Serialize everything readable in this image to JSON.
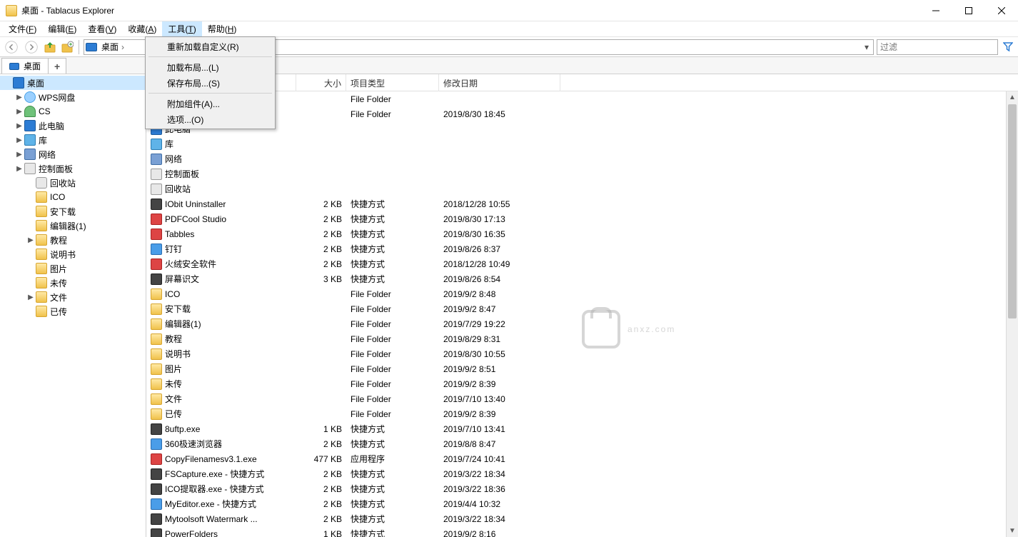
{
  "window": {
    "title": "桌面 - Tablacus Explorer"
  },
  "menubar": [
    {
      "label": "文件",
      "key": "F"
    },
    {
      "label": "编辑",
      "key": "E"
    },
    {
      "label": "查看",
      "key": "V"
    },
    {
      "label": "收藏",
      "key": "A"
    },
    {
      "label": "工具",
      "key": "T",
      "active": true
    },
    {
      "label": "帮助",
      "key": "H"
    }
  ],
  "tools_menu": [
    {
      "label": "重新加载自定义(R)"
    },
    {
      "sep": true
    },
    {
      "label": "加载布局...(L)"
    },
    {
      "label": "保存布局...(S)"
    },
    {
      "sep": true
    },
    {
      "label": "附加组件(A)..."
    },
    {
      "label": "选项...(O)"
    }
  ],
  "address": {
    "crumb": "桌面"
  },
  "filter": {
    "placeholder": "过滤"
  },
  "tabs": [
    {
      "label": "桌面",
      "active": true
    }
  ],
  "tree": [
    {
      "depth": 0,
      "icon": "ic-monitor",
      "label": "桌面",
      "twisty": "",
      "selected": true
    },
    {
      "depth": 1,
      "icon": "ic-cloud",
      "label": "WPS网盘",
      "twisty": ">"
    },
    {
      "depth": 1,
      "icon": "ic-user",
      "label": "CS",
      "twisty": ">"
    },
    {
      "depth": 1,
      "icon": "ic-monitor",
      "label": "此电脑",
      "twisty": ">"
    },
    {
      "depth": 1,
      "icon": "ic-lib",
      "label": "库",
      "twisty": ">"
    },
    {
      "depth": 1,
      "icon": "ic-net",
      "label": "网络",
      "twisty": ">"
    },
    {
      "depth": 1,
      "icon": "ic-panel",
      "label": "控制面板",
      "twisty": ">"
    },
    {
      "depth": 2,
      "icon": "ic-bin",
      "label": "回收站",
      "twisty": ""
    },
    {
      "depth": 2,
      "icon": "ic-folder",
      "label": "ICO",
      "twisty": ""
    },
    {
      "depth": 2,
      "icon": "ic-folder",
      "label": "安下载",
      "twisty": ""
    },
    {
      "depth": 2,
      "icon": "ic-folder",
      "label": "编辑器(1)",
      "twisty": ""
    },
    {
      "depth": 2,
      "icon": "ic-folder",
      "label": "教程",
      "twisty": ">"
    },
    {
      "depth": 2,
      "icon": "ic-folder",
      "label": "说明书",
      "twisty": ""
    },
    {
      "depth": 2,
      "icon": "ic-folder",
      "label": "图片",
      "twisty": ""
    },
    {
      "depth": 2,
      "icon": "ic-folder",
      "label": "未传",
      "twisty": ""
    },
    {
      "depth": 2,
      "icon": "ic-folder",
      "label": "文件",
      "twisty": ">"
    },
    {
      "depth": 2,
      "icon": "ic-folder",
      "label": "已传",
      "twisty": ""
    }
  ],
  "columns": {
    "name": "",
    "size": "大小",
    "type": "项目类型",
    "date": "修改日期"
  },
  "rows": [
    {
      "icon": "ic-cloud",
      "name": "",
      "size": "",
      "type": "File Folder",
      "date": ""
    },
    {
      "icon": "ic-user",
      "name": "",
      "size": "",
      "type": "File Folder",
      "date": "2019/8/30 18:45"
    },
    {
      "icon": "ic-monitor",
      "name": "此电脑",
      "size": "",
      "type": "",
      "date": ""
    },
    {
      "icon": "ic-lib",
      "name": "库",
      "size": "",
      "type": "",
      "date": ""
    },
    {
      "icon": "ic-net",
      "name": "网络",
      "size": "",
      "type": "",
      "date": ""
    },
    {
      "icon": "ic-panel",
      "name": "控制面板",
      "size": "",
      "type": "",
      "date": ""
    },
    {
      "icon": "ic-bin",
      "name": "回收站",
      "size": "",
      "type": "",
      "date": ""
    },
    {
      "icon": "ic-app",
      "name": "IObit Uninstaller",
      "size": "2 KB",
      "type": "快捷方式",
      "date": "2018/12/28 10:55"
    },
    {
      "icon": "ic-app2",
      "name": "PDFCool Studio",
      "size": "2 KB",
      "type": "快捷方式",
      "date": "2019/8/30 17:13"
    },
    {
      "icon": "ic-app2",
      "name": "Tabbles",
      "size": "2 KB",
      "type": "快捷方式",
      "date": "2019/8/30 16:35"
    },
    {
      "icon": "ic-app3",
      "name": "钉钉",
      "size": "2 KB",
      "type": "快捷方式",
      "date": "2019/8/26 8:37"
    },
    {
      "icon": "ic-app2",
      "name": "火绒安全软件",
      "size": "2 KB",
      "type": "快捷方式",
      "date": "2018/12/28 10:49"
    },
    {
      "icon": "ic-app",
      "name": "屏幕识文",
      "size": "3 KB",
      "type": "快捷方式",
      "date": "2019/8/26 8:54"
    },
    {
      "icon": "ic-folder",
      "name": "ICO",
      "size": "",
      "type": "File Folder",
      "date": "2019/9/2 8:48"
    },
    {
      "icon": "ic-folder",
      "name": "安下载",
      "size": "",
      "type": "File Folder",
      "date": "2019/9/2 8:47"
    },
    {
      "icon": "ic-folder",
      "name": "编辑器(1)",
      "size": "",
      "type": "File Folder",
      "date": "2019/7/29 19:22"
    },
    {
      "icon": "ic-folder",
      "name": "教程",
      "size": "",
      "type": "File Folder",
      "date": "2019/8/29 8:31"
    },
    {
      "icon": "ic-folder",
      "name": "说明书",
      "size": "",
      "type": "File Folder",
      "date": "2019/8/30 10:55"
    },
    {
      "icon": "ic-folder",
      "name": "图片",
      "size": "",
      "type": "File Folder",
      "date": "2019/9/2 8:51"
    },
    {
      "icon": "ic-folder",
      "name": "未传",
      "size": "",
      "type": "File Folder",
      "date": "2019/9/2 8:39"
    },
    {
      "icon": "ic-folder",
      "name": "文件",
      "size": "",
      "type": "File Folder",
      "date": "2019/7/10 13:40"
    },
    {
      "icon": "ic-folder",
      "name": "已传",
      "size": "",
      "type": "File Folder",
      "date": "2019/9/2 8:39"
    },
    {
      "icon": "ic-app",
      "name": "8uftp.exe",
      "size": "1 KB",
      "type": "快捷方式",
      "date": "2019/7/10 13:41"
    },
    {
      "icon": "ic-app3",
      "name": "360极速浏览器",
      "size": "2 KB",
      "type": "快捷方式",
      "date": "2019/8/8 8:47"
    },
    {
      "icon": "ic-app2",
      "name": "CopyFilenamesv3.1.exe",
      "size": "477 KB",
      "type": "应用程序",
      "date": "2019/7/24 10:41"
    },
    {
      "icon": "ic-app",
      "name": "FSCapture.exe - 快捷方式",
      "size": "2 KB",
      "type": "快捷方式",
      "date": "2019/3/22 18:34"
    },
    {
      "icon": "ic-app",
      "name": "ICO提取器.exe - 快捷方式",
      "size": "2 KB",
      "type": "快捷方式",
      "date": "2019/3/22 18:36"
    },
    {
      "icon": "ic-app3",
      "name": "MyEditor.exe - 快捷方式",
      "size": "2 KB",
      "type": "快捷方式",
      "date": "2019/4/4 10:32"
    },
    {
      "icon": "ic-app",
      "name": "Mytoolsoft Watermark ...",
      "size": "2 KB",
      "type": "快捷方式",
      "date": "2019/3/22 18:34"
    },
    {
      "icon": "ic-app",
      "name": "PowerFolders",
      "size": "1 KB",
      "type": "快捷方式",
      "date": "2019/9/2 8:16"
    }
  ],
  "watermark": {
    "text": "anxz.com"
  }
}
